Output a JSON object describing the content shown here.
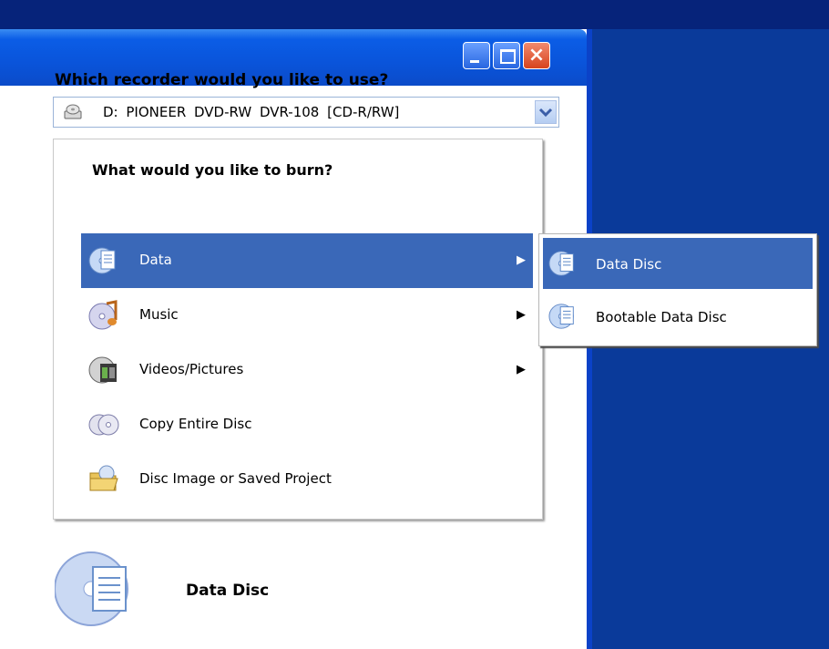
{
  "window": {
    "buttons": {
      "minimize": "minimize",
      "maximize": "maximize",
      "close": "close"
    }
  },
  "recorder": {
    "question": "Which recorder would you like to use?",
    "selected": "D: PIONEER DVD-RW DVR-108 [CD-R/RW]"
  },
  "burn_menu": {
    "heading": "What would you like to burn?",
    "items": [
      {
        "label": "Data",
        "icon": "data-disc-icon",
        "has_submenu": true,
        "selected": true
      },
      {
        "label": "Music",
        "icon": "music-icon",
        "has_submenu": true
      },
      {
        "label": "Videos/Pictures",
        "icon": "video-icon",
        "has_submenu": true
      },
      {
        "label": "Copy Entire Disc",
        "icon": "copy-disc-icon",
        "has_submenu": false
      },
      {
        "label": "Disc Image or Saved Project",
        "icon": "folder-icon",
        "has_submenu": false
      }
    ]
  },
  "submenu": {
    "items": [
      {
        "label": "Data Disc",
        "icon": "data-disc-icon",
        "selected": true
      },
      {
        "label": "Bootable Data Disc",
        "icon": "data-disc-icon"
      }
    ]
  },
  "selection_preview": {
    "label": "Data Disc",
    "icon": "data-disc-icon"
  },
  "arrow_glyph": "▶",
  "colors": {
    "highlight": "#3a68b8",
    "desktop": "#0a3a9a",
    "titlebar": "#0b5de6"
  }
}
